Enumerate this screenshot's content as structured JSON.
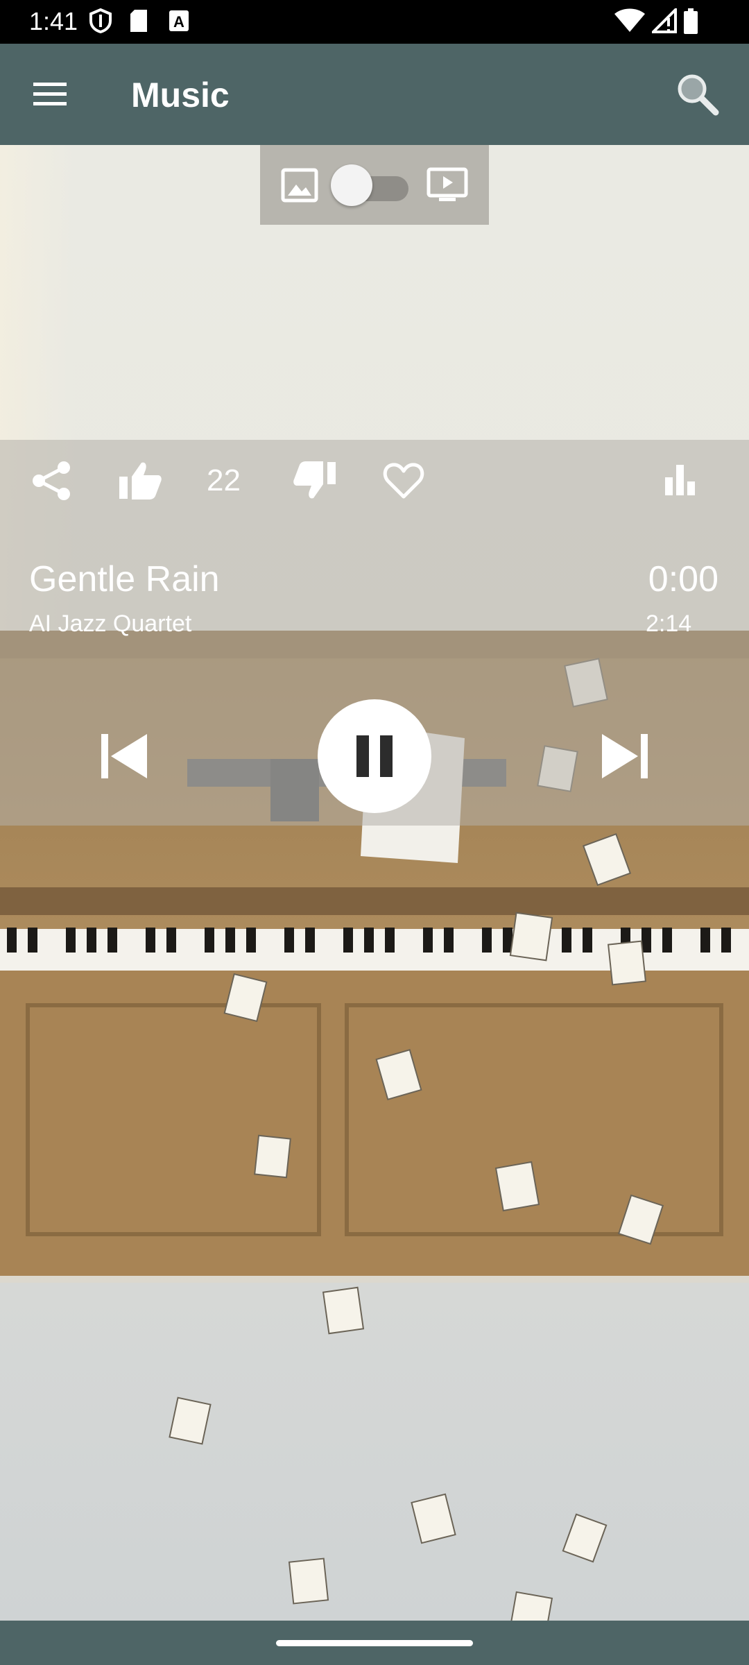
{
  "status_bar": {
    "time": "1:41",
    "icons": [
      "shield-icon",
      "sd-card-icon",
      "a-badge-icon",
      "wifi-icon",
      "signal-icon",
      "battery-icon"
    ]
  },
  "app_bar": {
    "title": "Music",
    "menu_icon": "hamburger-menu-icon",
    "search_icon": "search-icon"
  },
  "mode_toggle": {
    "left_icon": "image-icon",
    "right_icon": "screen-icon",
    "enabled": false
  },
  "actions": {
    "share_icon": "share-icon",
    "like_icon": "thumb-up-icon",
    "like_count": "22",
    "dislike_icon": "thumb-down-icon",
    "favorite_icon": "heart-icon",
    "stats_icon": "bar-chart-icon"
  },
  "track": {
    "title": "Gentle Rain",
    "artist": "AI Jazz Quartet",
    "elapsed": "0:00",
    "duration": "2:14"
  },
  "controls": {
    "previous_icon": "skip-previous-icon",
    "pause_icon": "pause-icon",
    "next_icon": "skip-next-icon"
  },
  "colors": {
    "app_bar": "#4e6566",
    "status_bar": "#000000",
    "overlay": "#b4b0aa",
    "text": "#ffffff"
  }
}
